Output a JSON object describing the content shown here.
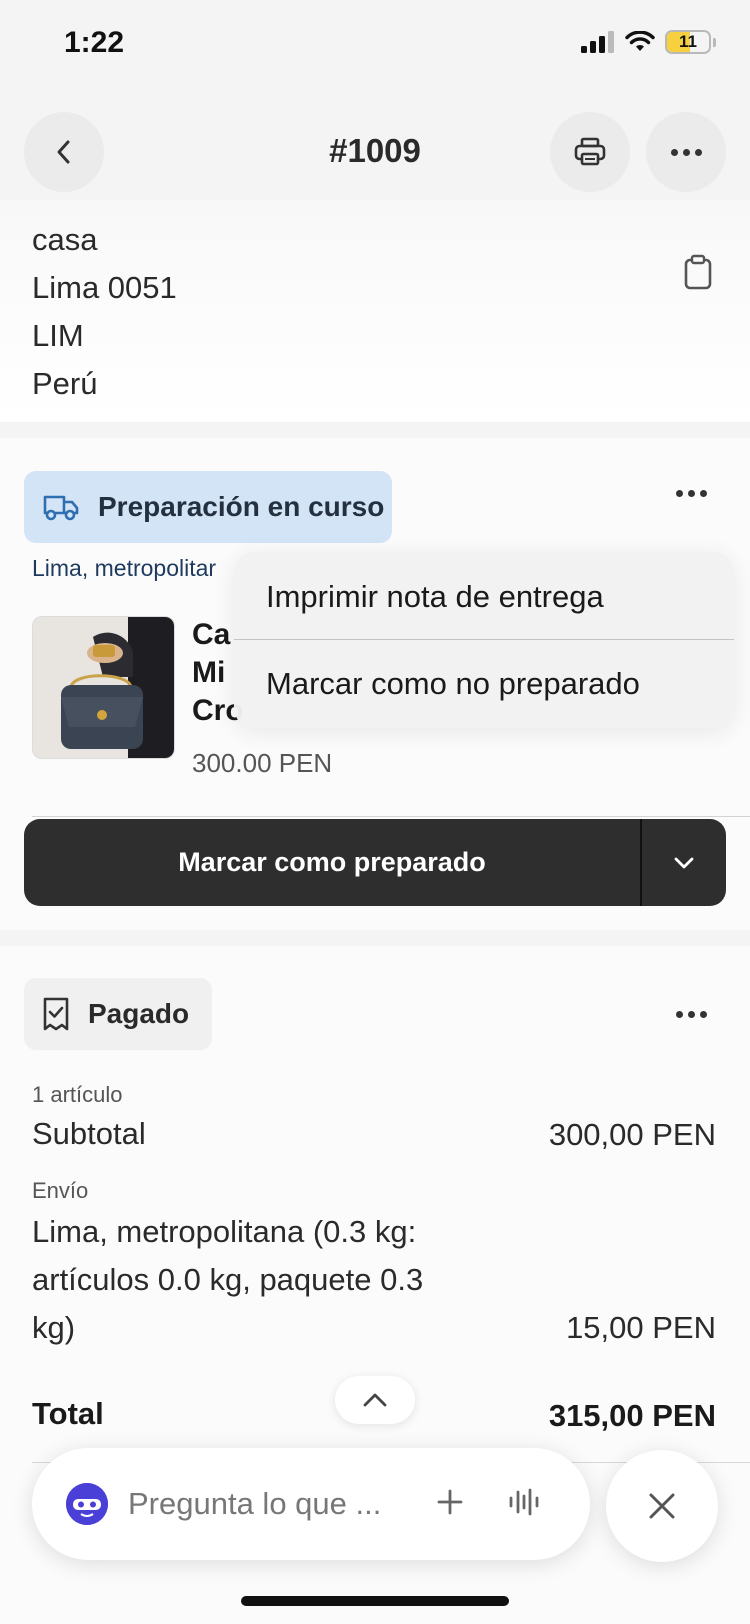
{
  "status_bar": {
    "time": "1:22",
    "battery": "11"
  },
  "header": {
    "title": "#1009"
  },
  "address": {
    "lines": [
      "casa",
      "Lima 0051",
      "LIM",
      "Perú"
    ]
  },
  "fulfillment": {
    "status_label": "Preparación en curso",
    "location": "Lima, metropolitar",
    "product": {
      "title_lines": [
        "Ca",
        "Mi",
        "Cro"
      ],
      "price": "300.00 PEN"
    },
    "primary_action": "Marcar como preparado"
  },
  "menu": {
    "items": [
      "Imprimir nota de entrega",
      "Marcar como no preparado"
    ]
  },
  "payment": {
    "status_label": "Pagado",
    "items_count": "1 artículo",
    "subtotal_label": "Subtotal",
    "subtotal_value": "300,00 PEN",
    "shipping_label": "Envío",
    "shipping_lines": [
      "Lima, metropolitana (0.3 kg:",
      "artículos 0.0 kg, paquete 0.3",
      "kg)"
    ],
    "shipping_value": "15,00 PEN",
    "total_label": "Total",
    "total_value": "315,00 PEN"
  },
  "assistant": {
    "placeholder": "Pregunta lo que ..."
  },
  "icons": {
    "back": "chevron-left-icon",
    "print": "printer-icon",
    "more": "more-horizontal-icon",
    "copy": "clipboard-icon",
    "truck": "truck-icon",
    "receipt": "receipt-check-icon",
    "dropdown": "chevron-down-icon",
    "scroll_up": "chevron-up-icon",
    "add": "plus-icon",
    "voice": "waveform-icon",
    "close": "close-icon"
  },
  "colors": {
    "prep_badge_bg": "#d3e4f6",
    "primary_button_bg": "#2e2e2e",
    "assistant_avatar": "#4a3fd6",
    "battery": "#f6d03f"
  }
}
